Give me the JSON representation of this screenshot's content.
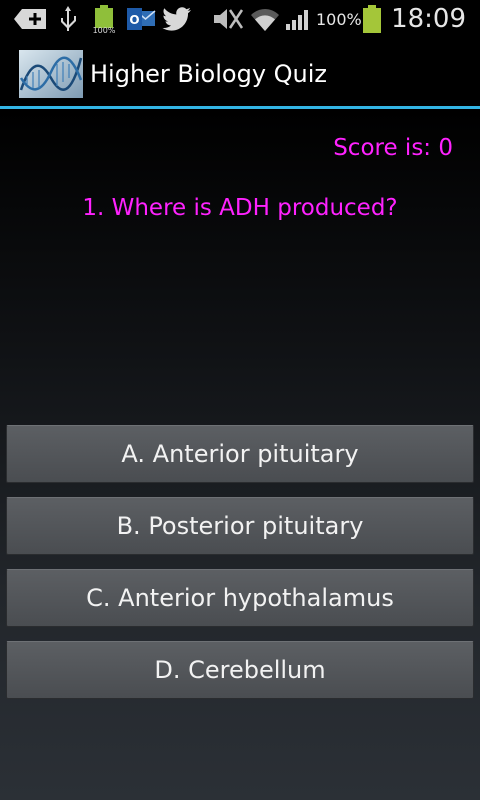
{
  "status_bar": {
    "time": "18:09",
    "battery_percent": "100%",
    "notification_icons": [
      "add-icon",
      "usb-icon",
      "battery-full-icon",
      "outlook-icon",
      "twitter-icon"
    ],
    "system_icons": [
      "mute-icon",
      "wifi-icon",
      "signal-icon",
      "battery-icon"
    ],
    "accent_battery": "#a4c639"
  },
  "action_bar": {
    "title": "Higher Biology Quiz",
    "logo_icon": "dna-helix-icon",
    "divider_color": "#33b5e5"
  },
  "quiz": {
    "score_label": "Score is: 0",
    "question": "1. Where is ADH produced?",
    "text_color": "#ff22ff",
    "answers": [
      {
        "label": "A. Anterior pituitary"
      },
      {
        "label": "B. Posterior pituitary"
      },
      {
        "label": "C. Anterior hypothalamus"
      },
      {
        "label": "D. Cerebellum"
      }
    ]
  }
}
